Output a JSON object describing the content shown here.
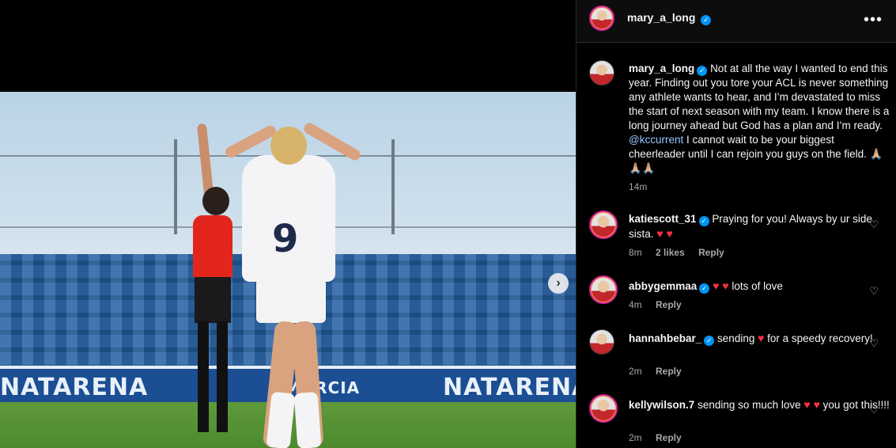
{
  "post": {
    "username": "mary_a_long",
    "caption_user": "mary_a_long",
    "caption_before_mention": "Not at all the way I wanted to end this year. Finding out you tore your ACL is never something any athlete wants to hear, and I’m devastated to miss the start of next season with my team. I know there is a long journey ahead but God has a plan and I’m ready.",
    "mention": "@kccurrent",
    "caption_after_mention": "I cannot wait to be your biggest cheerleader until I can rejoin you guys on the field. 🙏🏼🙏🏼🙏🏼",
    "caption_time": "14m",
    "more_icon": "•••"
  },
  "media": {
    "jersey_number": "9",
    "board_text_left": "NATARENA",
    "board_text_mid": "MURCIA",
    "board_text_right": "NATARENA",
    "next_icon": "›"
  },
  "comments": [
    {
      "user": "katiescott_31",
      "verified": true,
      "text": "Praying for you! Always by ur side sista. ",
      "hearts": "♥ ♥",
      "time": "8m",
      "likes": "2 likes",
      "reply": "Reply"
    },
    {
      "user": "abbygemmaa",
      "verified": true,
      "text_before": "",
      "hearts": "♥ ♥",
      "text": " lots of love",
      "time": "4m",
      "reply": "Reply"
    },
    {
      "user": "hannahbebar_",
      "verified": true,
      "text_before": "sending ",
      "hearts": "♥",
      "text": " for a speedy recovery!",
      "time": "2m",
      "reply": "Reply"
    },
    {
      "user": "kellywilson.7",
      "verified": false,
      "text_before": "sending so much love ",
      "hearts": "♥ ♥",
      "text": " you got this!!!!",
      "time": "2m",
      "reply": "Reply"
    }
  ],
  "icons": {
    "verified": "✓",
    "like": "♡"
  }
}
